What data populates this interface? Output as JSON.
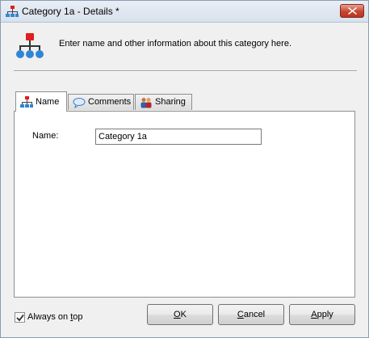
{
  "window": {
    "title": "Category 1a - Details *",
    "close_label": "Close"
  },
  "header": {
    "description": "Enter name and other information about this category here.",
    "icon": "category-hierarchy-icon"
  },
  "tabs": [
    {
      "label": "Name",
      "icon": "category-hierarchy-icon",
      "active": true
    },
    {
      "label": "Comments",
      "icon": "speech-bubble-icon",
      "active": false
    },
    {
      "label": "Sharing",
      "icon": "people-icon",
      "active": false
    }
  ],
  "form": {
    "name_label": "Name:",
    "name_value": "Category 1a"
  },
  "footer": {
    "always_on_top": {
      "checked": true,
      "label_pre": "Always on ",
      "label_accel": "t",
      "label_post": "op"
    },
    "buttons": {
      "ok_accel": "O",
      "ok_rest": "K",
      "cancel_accel": "C",
      "cancel_rest": "ancel",
      "apply_accel": "A",
      "apply_rest": "pply"
    }
  },
  "colors": {
    "icon_red": "#e11d1d",
    "icon_blue": "#2f86d6",
    "close_red": "#c9452f"
  }
}
